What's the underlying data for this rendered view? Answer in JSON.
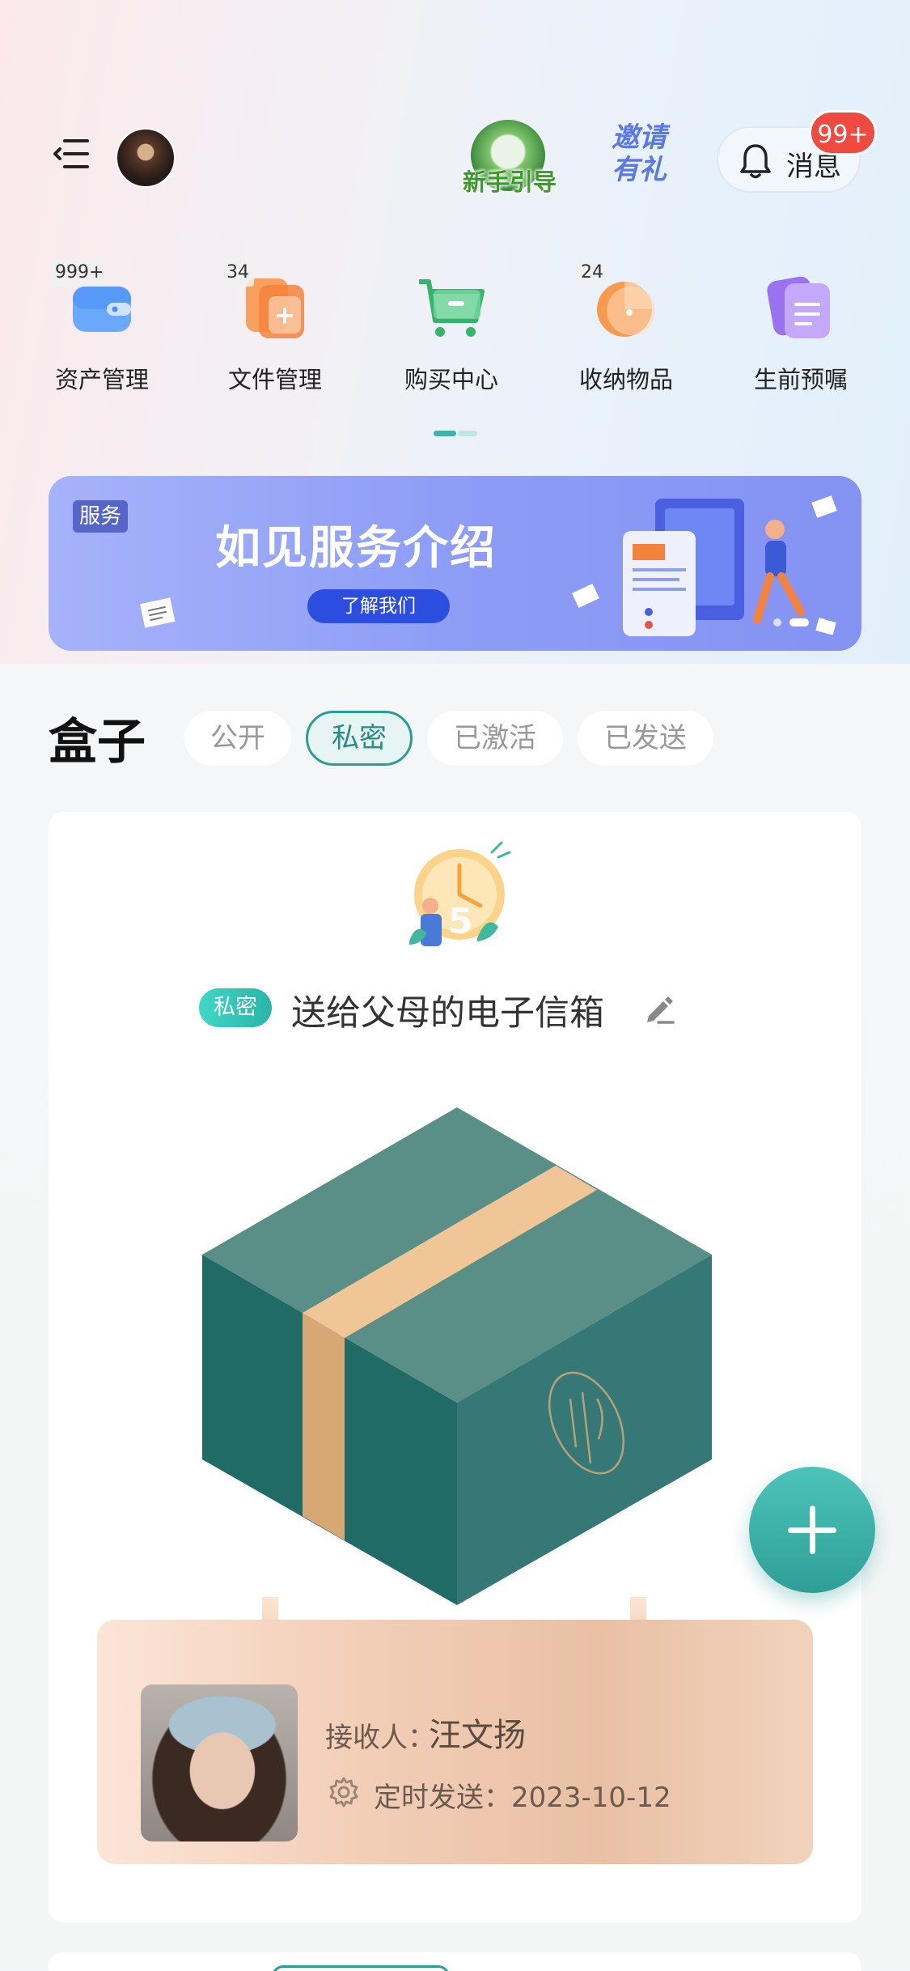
{
  "header": {
    "guide_label": "新手引导",
    "invite_line1": "邀请",
    "invite_line2": "有礼",
    "messages_label": "消息",
    "messages_badge": "99+"
  },
  "shortcuts": [
    {
      "label": "资产管理",
      "count": "999+",
      "icon": "wallet-icon",
      "color": "#4a8ff5"
    },
    {
      "label": "文件管理",
      "count": "34",
      "icon": "file-add-icon",
      "color": "#f5823c"
    },
    {
      "label": "购买中心",
      "count": "",
      "icon": "cart-icon",
      "color": "#35b56b"
    },
    {
      "label": "收纳物品",
      "count": "24",
      "icon": "storage-icon",
      "color": "#f58c3c"
    },
    {
      "label": "生前预嘱",
      "count": "",
      "icon": "document-icon",
      "color": "#9a72f0"
    }
  ],
  "banner": {
    "tag": "服务",
    "title": "如见服务介绍",
    "button": "了解我们"
  },
  "boxes": {
    "title": "盒子",
    "filters": [
      {
        "label": "公开",
        "active": false
      },
      {
        "label": "私密",
        "active": true
      },
      {
        "label": "已激活",
        "active": false
      },
      {
        "label": "已发送",
        "active": false
      }
    ]
  },
  "card": {
    "privacy_tag": "私密",
    "title": "送给父母的电子信箱",
    "receiver_label": "接收人：",
    "receiver_name": "汪文扬",
    "schedule_label": "定时发送：2023-10-12"
  },
  "colors": {
    "accent": "#2a9d95",
    "badge": "#ef4a3f",
    "banner_button": "#2b4ee0"
  }
}
